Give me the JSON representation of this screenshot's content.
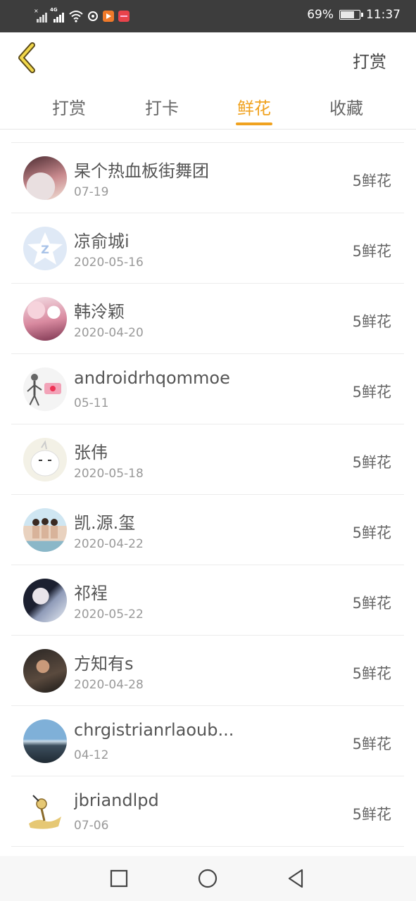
{
  "status_bar": {
    "battery": "69%",
    "time": "11:37",
    "network": "4G",
    "icons": [
      "signal-icon",
      "signal-4g-icon",
      "wifi-icon",
      "sync-icon",
      "video-app-icon",
      "red-app-icon",
      "battery-icon"
    ]
  },
  "header": {
    "back_icon": "chevron-left-icon",
    "action_label": "打赏",
    "accent_color": "#f0a21f"
  },
  "tabs": [
    {
      "label": "打赏",
      "active": false
    },
    {
      "label": "打卡",
      "active": false
    },
    {
      "label": "鲜花",
      "active": true
    },
    {
      "label": "收藏",
      "active": false
    }
  ],
  "list": [
    {
      "name": "杲个热血板街舞团",
      "date": "07-19",
      "amount": "5鲜花"
    },
    {
      "name": "凉俞城i",
      "date": "2020-05-16",
      "amount": "5鲜花"
    },
    {
      "name": "韩泠颖",
      "date": "2020-04-20",
      "amount": "5鲜花"
    },
    {
      "name": "androidrhqommoe",
      "date": "05-11",
      "amount": "5鲜花"
    },
    {
      "name": "张伟",
      "date": "2020-05-18",
      "amount": "5鲜花"
    },
    {
      "name": "凯.源.玺",
      "date": "2020-04-22",
      "amount": "5鲜花"
    },
    {
      "name": "祁裎",
      "date": "2020-05-22",
      "amount": "5鲜花"
    },
    {
      "name": "方知有s",
      "date": "2020-04-28",
      "amount": "5鲜花"
    },
    {
      "name": "chrgistrianrlaoub...",
      "date": "04-12",
      "amount": "5鲜花"
    },
    {
      "name": "jbriandlpd",
      "date": "07-06",
      "amount": "5鲜花"
    }
  ],
  "navbar": {
    "icons": [
      "square-recents-icon",
      "circle-home-icon",
      "triangle-back-icon"
    ]
  }
}
